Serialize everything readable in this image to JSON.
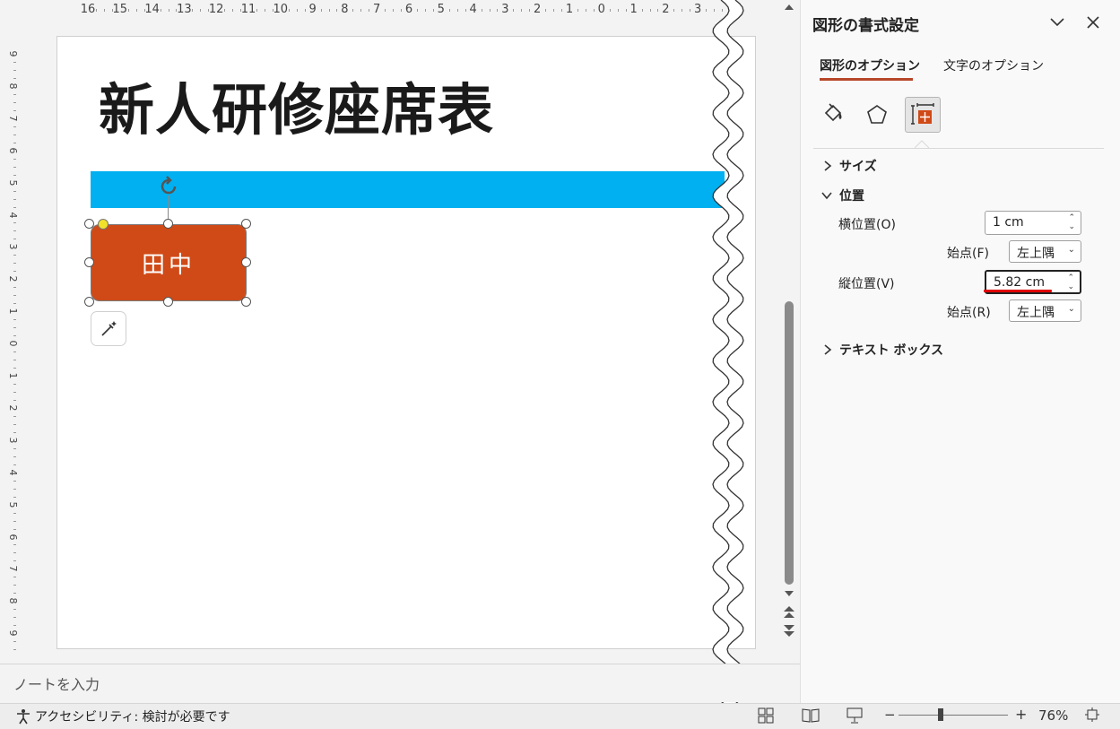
{
  "ruler": {
    "horizontal": [
      "16",
      "15",
      "14",
      "13",
      "12",
      "11",
      "10",
      "9",
      "8",
      "7",
      "6",
      "5",
      "4",
      "3",
      "2",
      "1",
      "0",
      "1",
      "2",
      "3"
    ],
    "vertical": [
      "9",
      "8",
      "7",
      "6",
      "5",
      "4",
      "3",
      "2",
      "1",
      "0",
      "1",
      "2",
      "3",
      "4",
      "5",
      "6",
      "7",
      "8",
      "9"
    ]
  },
  "slide": {
    "title": "新人研修座席表",
    "shape_text": "田中"
  },
  "notes": {
    "placeholder": "ノートを入力"
  },
  "status": {
    "accessibility": "アクセシビリティ: 検討が必要です",
    "zoom": "76%",
    "zoom_minus": "−",
    "zoom_plus": "+"
  },
  "pane": {
    "title": "図形の書式設定",
    "tabs": {
      "shape_options": "図形のオプション",
      "text_options": "文字のオプション"
    },
    "sections": {
      "size": "サイズ",
      "position": "位置",
      "textbox": "テキスト ボックス"
    },
    "horizontal_position": {
      "label": "横位置(O)",
      "value": "1 cm"
    },
    "horizontal_origin": {
      "label": "始点(F)",
      "value": "左上隅"
    },
    "vertical_position": {
      "label": "縦位置(V)",
      "value": "5.82 cm"
    },
    "vertical_origin": {
      "label": "始点(R)",
      "value": "左上隅"
    }
  },
  "colors": {
    "accent": "#b7472a",
    "band": "#00b0f0",
    "shape_fill": "#d04a17",
    "highlight": "#e00000"
  }
}
